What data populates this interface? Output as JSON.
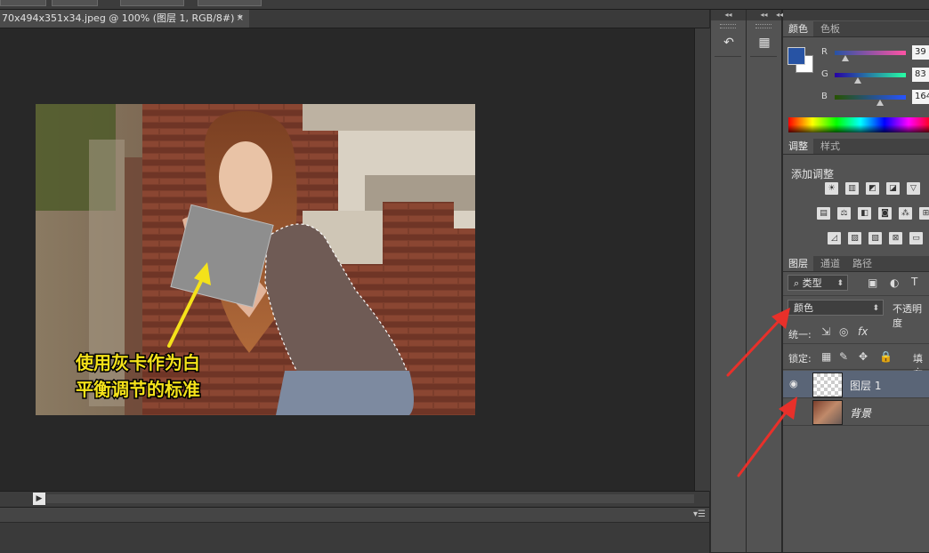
{
  "document": {
    "tab_title": "70x494x351x34.jpeg @ 100% (图层 1, RGB/8#) *",
    "close_glyph": "×"
  },
  "photo": {
    "caption_line1": "使用灰卡作为白",
    "caption_line2": "平衡调节的标准"
  },
  "dock": {
    "collapse_glyph": "◂◂",
    "history_icon": "history-icon",
    "properties_icon": "properties-icon"
  },
  "color_panel": {
    "tabs": [
      "颜色",
      "色板"
    ],
    "foreground_color": "#2753a4",
    "background_color": "#ffffff",
    "channels": [
      {
        "label": "R",
        "value": "39",
        "fraction": 0.15,
        "gradient": "linear-gradient(to right,#2753a4,#ff53a4)"
      },
      {
        "label": "G",
        "value": "83",
        "fraction": 0.33,
        "gradient": "linear-gradient(to right,#2700a4,#27ffa4)"
      },
      {
        "label": "B",
        "value": "164",
        "fraction": 0.64,
        "gradient": "linear-gradient(to right,#275300,#2753ff)"
      }
    ]
  },
  "adjustments_panel": {
    "tabs": [
      "调整",
      "样式"
    ],
    "title": "添加调整",
    "rows": [
      [
        "brightness-contrast-icon",
        "levels-icon",
        "curves-icon",
        "exposure-icon",
        "vibrance-icon"
      ],
      [
        "hue-saturation-icon",
        "color-balance-icon",
        "black-white-icon",
        "photo-filter-icon",
        "channel-mixer-icon",
        "color-lookup-icon"
      ],
      [
        "invert-icon",
        "posterize-icon",
        "threshold-icon",
        "selective-color-icon",
        "gradient-map-icon"
      ]
    ],
    "glyphs": [
      [
        "☀",
        "▥",
        "◩",
        "◪",
        "▽"
      ],
      [
        "▤",
        "⚖",
        "◧",
        "◙",
        "⁂",
        "⊞"
      ],
      [
        "◿",
        "▨",
        "▧",
        "⊠",
        "▭"
      ]
    ]
  },
  "layers_panel": {
    "tabs": [
      "图层",
      "通道",
      "路径"
    ],
    "filter_label": "类型",
    "filter_search_glyph": "⌕",
    "blend_mode": "颜色",
    "opacity_label": "不透明度",
    "unify_label": "统一:",
    "lock_label": "锁定:",
    "fill_label": "填充",
    "layers": [
      {
        "name": "图层 1",
        "visible": true,
        "selected": true
      },
      {
        "name": "背景",
        "visible": false,
        "selected": false
      }
    ]
  },
  "annotations": {
    "arrow_color": "#e8302a"
  }
}
